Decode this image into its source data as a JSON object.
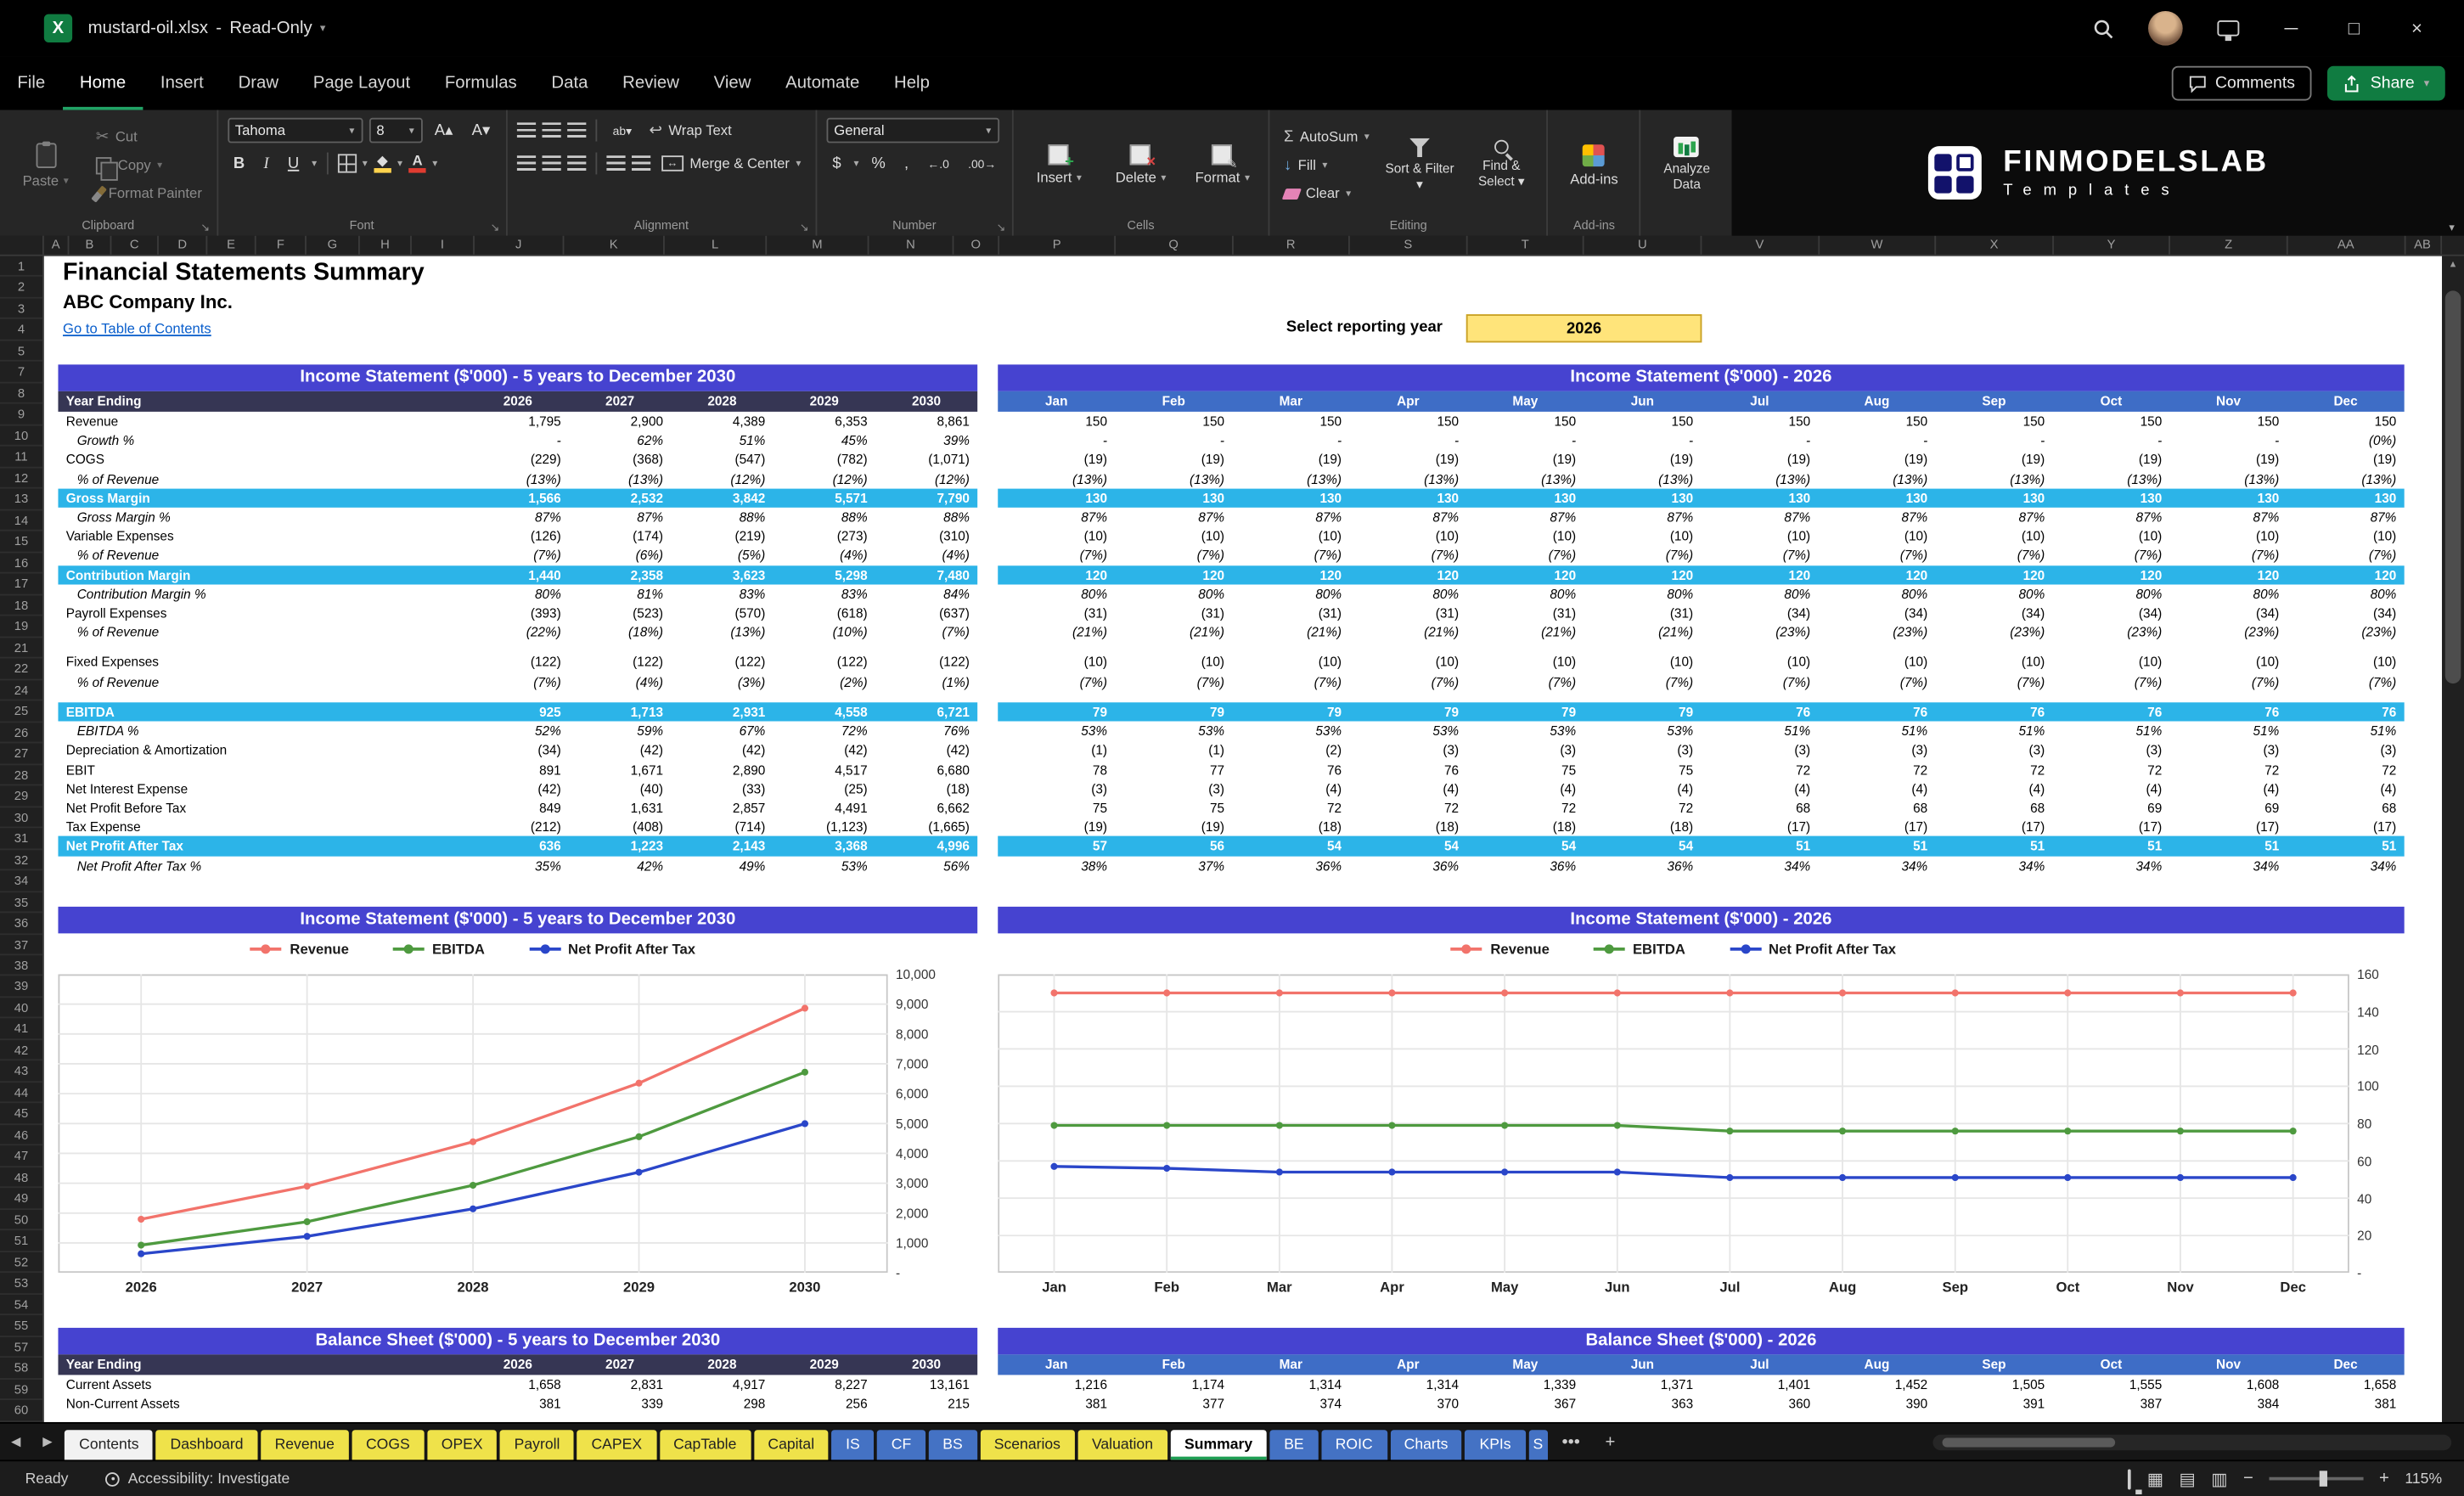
{
  "titlebar": {
    "filename": "mustard-oil.xlsx",
    "separator": "-",
    "mode": "Read-Only"
  },
  "menubar": {
    "items": [
      "File",
      "Home",
      "Insert",
      "Draw",
      "Page Layout",
      "Formulas",
      "Data",
      "Review",
      "View",
      "Automate",
      "Help"
    ],
    "active": "Home",
    "comments": "Comments",
    "share": "Share"
  },
  "ribbon": {
    "groups": {
      "clipboard": "Clipboard",
      "font": "Font",
      "alignment": "Alignment",
      "number": "Number",
      "cells": "Cells",
      "editing": "Editing",
      "addins": "Add-ins"
    },
    "paste": "Paste",
    "cut": "Cut",
    "copy": "Copy",
    "format_painter": "Format Painter",
    "font_name": "Tahoma",
    "font_size": "8",
    "wrap_text": "Wrap Text",
    "merge_center": "Merge & Center",
    "number_format": "General",
    "insert": "Insert",
    "delete": "Delete",
    "format": "Format",
    "autosum": "AutoSum",
    "fill": "Fill",
    "clear": "Clear",
    "sort_filter": "Sort & Filter",
    "find_select": "Find & Select",
    "addins_btn": "Add-ins",
    "analyze": "Analyze Data"
  },
  "logo": {
    "title": "FINMODELSLAB",
    "subtitle": "Templates"
  },
  "grid": {
    "columns": [
      "A",
      "B",
      "C",
      "D",
      "E",
      "F",
      "G",
      "H",
      "I",
      "J",
      "K",
      "L",
      "M",
      "N",
      "O",
      "P",
      "Q",
      "R",
      "S",
      "T",
      "U",
      "V",
      "W",
      "X",
      "Y",
      "Z",
      "AA",
      "AB"
    ],
    "rows": [
      1,
      2,
      3,
      4,
      5,
      7,
      8,
      9,
      10,
      11,
      12,
      13,
      14,
      15,
      16,
      17,
      18,
      19,
      21,
      22,
      24,
      25,
      26,
      27,
      28,
      29,
      30,
      31,
      32,
      34,
      35,
      36,
      37,
      38,
      39,
      40,
      41,
      42,
      43,
      44,
      45,
      46,
      47,
      48,
      49,
      50,
      51,
      52,
      53,
      54,
      55,
      57,
      58,
      59,
      60
    ]
  },
  "sheet": {
    "title": "Financial Statements Summary",
    "company": "ABC Company Inc.",
    "toc": "Go to Table of Contents",
    "year_label": "Select reporting year",
    "year": "2026"
  },
  "annual_is": {
    "title": "Income Statement ($'000) - 5 years to December 2030",
    "header_label": "Year Ending",
    "columns": [
      "2026",
      "2027",
      "2028",
      "2029",
      "2030"
    ],
    "rows": [
      {
        "label": "Revenue",
        "style": "n",
        "values": [
          "1,795",
          "2,900",
          "4,389",
          "6,353",
          "8,861"
        ]
      },
      {
        "label": "Growth %",
        "style": "p",
        "values": [
          "-",
          "62%",
          "51%",
          "45%",
          "39%"
        ]
      },
      {
        "label": "COGS",
        "style": "n",
        "values": [
          "(229)",
          "(368)",
          "(547)",
          "(782)",
          "(1,071)"
        ]
      },
      {
        "label": "% of Revenue",
        "style": "p",
        "values": [
          "(13%)",
          "(13%)",
          "(12%)",
          "(12%)",
          "(12%)"
        ]
      },
      {
        "label": "Gross Margin",
        "style": "h",
        "values": [
          "1,566",
          "2,532",
          "3,842",
          "5,571",
          "7,790"
        ]
      },
      {
        "label": "Gross Margin %",
        "style": "p",
        "values": [
          "87%",
          "87%",
          "88%",
          "88%",
          "88%"
        ]
      },
      {
        "label": "Variable Expenses",
        "style": "n",
        "values": [
          "(126)",
          "(174)",
          "(219)",
          "(273)",
          "(310)"
        ]
      },
      {
        "label": "% of Revenue",
        "style": "p",
        "values": [
          "(7%)",
          "(6%)",
          "(5%)",
          "(4%)",
          "(4%)"
        ]
      },
      {
        "label": "Contribution Margin",
        "style": "h",
        "values": [
          "1,440",
          "2,358",
          "3,623",
          "5,298",
          "7,480"
        ]
      },
      {
        "label": "Contribution Margin %",
        "style": "p",
        "values": [
          "80%",
          "81%",
          "83%",
          "83%",
          "84%"
        ]
      },
      {
        "label": "Payroll Expenses",
        "style": "n",
        "values": [
          "(393)",
          "(523)",
          "(570)",
          "(618)",
          "(637)"
        ]
      },
      {
        "label": "% of Revenue",
        "style": "p",
        "values": [
          "(22%)",
          "(18%)",
          "(13%)",
          "(10%)",
          "(7%)"
        ]
      },
      {
        "style": "s"
      },
      {
        "label": "Fixed Expenses",
        "style": "n",
        "values": [
          "(122)",
          "(122)",
          "(122)",
          "(122)",
          "(122)"
        ]
      },
      {
        "label": "% of Revenue",
        "style": "p",
        "values": [
          "(7%)",
          "(4%)",
          "(3%)",
          "(2%)",
          "(1%)"
        ]
      },
      {
        "style": "s"
      },
      {
        "label": "EBITDA",
        "style": "h",
        "values": [
          "925",
          "1,713",
          "2,931",
          "4,558",
          "6,721"
        ]
      },
      {
        "label": "EBITDA %",
        "style": "p",
        "values": [
          "52%",
          "59%",
          "67%",
          "72%",
          "76%"
        ]
      },
      {
        "label": "Depreciation & Amortization",
        "style": "n",
        "values": [
          "(34)",
          "(42)",
          "(42)",
          "(42)",
          "(42)"
        ]
      },
      {
        "label": "EBIT",
        "style": "n",
        "values": [
          "891",
          "1,671",
          "2,890",
          "4,517",
          "6,680"
        ]
      },
      {
        "label": "Net Interest Expense",
        "style": "n",
        "values": [
          "(42)",
          "(40)",
          "(33)",
          "(25)",
          "(18)"
        ]
      },
      {
        "label": "Net Profit Before Tax",
        "style": "n",
        "values": [
          "849",
          "1,631",
          "2,857",
          "4,491",
          "6,662"
        ]
      },
      {
        "label": "Tax Expense",
        "style": "n",
        "values": [
          "(212)",
          "(408)",
          "(714)",
          "(1,123)",
          "(1,665)"
        ]
      },
      {
        "label": "Net Profit After Tax",
        "style": "h",
        "values": [
          "636",
          "1,223",
          "2,143",
          "3,368",
          "4,996"
        ]
      },
      {
        "label": "Net Profit After Tax %",
        "style": "p",
        "values": [
          "35%",
          "42%",
          "49%",
          "53%",
          "56%"
        ]
      }
    ]
  },
  "monthly_is": {
    "title": "Income Statement ($'000) - 2026",
    "columns": [
      "Jan",
      "Feb",
      "Mar",
      "Apr",
      "May",
      "Jun",
      "Jul",
      "Aug",
      "Sep",
      "Oct",
      "Nov",
      "Dec"
    ],
    "rows": [
      {
        "style": "n",
        "values": [
          "150",
          "150",
          "150",
          "150",
          "150",
          "150",
          "150",
          "150",
          "150",
          "150",
          "150",
          "150"
        ]
      },
      {
        "style": "p",
        "values": [
          "-",
          "-",
          "-",
          "-",
          "-",
          "-",
          "-",
          "-",
          "-",
          "-",
          "-",
          "(0%)"
        ]
      },
      {
        "style": "n",
        "values": [
          "(19)",
          "(19)",
          "(19)",
          "(19)",
          "(19)",
          "(19)",
          "(19)",
          "(19)",
          "(19)",
          "(19)",
          "(19)",
          "(19)"
        ]
      },
      {
        "style": "p",
        "values": [
          "(13%)",
          "(13%)",
          "(13%)",
          "(13%)",
          "(13%)",
          "(13%)",
          "(13%)",
          "(13%)",
          "(13%)",
          "(13%)",
          "(13%)",
          "(13%)"
        ]
      },
      {
        "style": "h",
        "values": [
          "130",
          "130",
          "130",
          "130",
          "130",
          "130",
          "130",
          "130",
          "130",
          "130",
          "130",
          "130"
        ]
      },
      {
        "style": "p",
        "values": [
          "87%",
          "87%",
          "87%",
          "87%",
          "87%",
          "87%",
          "87%",
          "87%",
          "87%",
          "87%",
          "87%",
          "87%"
        ]
      },
      {
        "style": "n",
        "values": [
          "(10)",
          "(10)",
          "(10)",
          "(10)",
          "(10)",
          "(10)",
          "(10)",
          "(10)",
          "(10)",
          "(10)",
          "(10)",
          "(10)"
        ]
      },
      {
        "style": "p",
        "values": [
          "(7%)",
          "(7%)",
          "(7%)",
          "(7%)",
          "(7%)",
          "(7%)",
          "(7%)",
          "(7%)",
          "(7%)",
          "(7%)",
          "(7%)",
          "(7%)"
        ]
      },
      {
        "style": "h",
        "values": [
          "120",
          "120",
          "120",
          "120",
          "120",
          "120",
          "120",
          "120",
          "120",
          "120",
          "120",
          "120"
        ]
      },
      {
        "style": "p",
        "values": [
          "80%",
          "80%",
          "80%",
          "80%",
          "80%",
          "80%",
          "80%",
          "80%",
          "80%",
          "80%",
          "80%",
          "80%"
        ]
      },
      {
        "style": "n",
        "values": [
          "(31)",
          "(31)",
          "(31)",
          "(31)",
          "(31)",
          "(31)",
          "(34)",
          "(34)",
          "(34)",
          "(34)",
          "(34)",
          "(34)"
        ]
      },
      {
        "style": "p",
        "values": [
          "(21%)",
          "(21%)",
          "(21%)",
          "(21%)",
          "(21%)",
          "(21%)",
          "(23%)",
          "(23%)",
          "(23%)",
          "(23%)",
          "(23%)",
          "(23%)"
        ]
      },
      {
        "style": "s"
      },
      {
        "style": "n",
        "values": [
          "(10)",
          "(10)",
          "(10)",
          "(10)",
          "(10)",
          "(10)",
          "(10)",
          "(10)",
          "(10)",
          "(10)",
          "(10)",
          "(10)"
        ]
      },
      {
        "style": "p",
        "values": [
          "(7%)",
          "(7%)",
          "(7%)",
          "(7%)",
          "(7%)",
          "(7%)",
          "(7%)",
          "(7%)",
          "(7%)",
          "(7%)",
          "(7%)",
          "(7%)"
        ]
      },
      {
        "style": "s"
      },
      {
        "style": "h",
        "values": [
          "79",
          "79",
          "79",
          "79",
          "79",
          "79",
          "76",
          "76",
          "76",
          "76",
          "76",
          "76"
        ]
      },
      {
        "style": "p",
        "values": [
          "53%",
          "53%",
          "53%",
          "53%",
          "53%",
          "53%",
          "51%",
          "51%",
          "51%",
          "51%",
          "51%",
          "51%"
        ]
      },
      {
        "style": "n",
        "values": [
          "(1)",
          "(1)",
          "(2)",
          "(3)",
          "(3)",
          "(3)",
          "(3)",
          "(3)",
          "(3)",
          "(3)",
          "(3)",
          "(3)"
        ]
      },
      {
        "style": "n",
        "values": [
          "78",
          "77",
          "76",
          "76",
          "75",
          "75",
          "72",
          "72",
          "72",
          "72",
          "72",
          "72"
        ]
      },
      {
        "style": "n",
        "values": [
          "(3)",
          "(3)",
          "(4)",
          "(4)",
          "(4)",
          "(4)",
          "(4)",
          "(4)",
          "(4)",
          "(4)",
          "(4)",
          "(4)"
        ]
      },
      {
        "style": "n",
        "values": [
          "75",
          "75",
          "72",
          "72",
          "72",
          "72",
          "68",
          "68",
          "68",
          "69",
          "69",
          "68"
        ]
      },
      {
        "style": "n",
        "values": [
          "(19)",
          "(19)",
          "(18)",
          "(18)",
          "(18)",
          "(18)",
          "(17)",
          "(17)",
          "(17)",
          "(17)",
          "(17)",
          "(17)"
        ]
      },
      {
        "style": "h",
        "values": [
          "57",
          "56",
          "54",
          "54",
          "54",
          "54",
          "51",
          "51",
          "51",
          "51",
          "51",
          "51"
        ]
      },
      {
        "style": "p",
        "values": [
          "38%",
          "37%",
          "36%",
          "36%",
          "36%",
          "36%",
          "34%",
          "34%",
          "34%",
          "34%",
          "34%",
          "34%"
        ]
      }
    ]
  },
  "annual_bs": {
    "title": "Balance Sheet ($'000) - 5 years to December 2030",
    "header_label": "Year Ending",
    "columns": [
      "2026",
      "2027",
      "2028",
      "2029",
      "2030"
    ],
    "rows": [
      {
        "label": "Current Assets",
        "style": "n",
        "values": [
          "1,658",
          "2,831",
          "4,917",
          "8,227",
          "13,161"
        ]
      },
      {
        "label": "Non-Current Assets",
        "style": "n",
        "values": [
          "381",
          "339",
          "298",
          "256",
          "215"
        ]
      }
    ]
  },
  "monthly_bs": {
    "title": "Balance Sheet ($'000) - 2026",
    "columns": [
      "Jan",
      "Feb",
      "Mar",
      "Apr",
      "May",
      "Jun",
      "Jul",
      "Aug",
      "Sep",
      "Oct",
      "Nov",
      "Dec"
    ],
    "rows": [
      {
        "style": "n",
        "values": [
          "1,216",
          "1,174",
          "1,314",
          "1,314",
          "1,339",
          "1,371",
          "1,401",
          "1,452",
          "1,505",
          "1,555",
          "1,608",
          "1,658"
        ]
      },
      {
        "style": "n",
        "values": [
          "381",
          "377",
          "374",
          "370",
          "367",
          "363",
          "360",
          "390",
          "391",
          "387",
          "384",
          "381"
        ]
      }
    ]
  },
  "chart_data": [
    {
      "type": "line",
      "title": "Income Statement ($'000) - 5 years to December 2030",
      "x": [
        "2026",
        "2027",
        "2028",
        "2029",
        "2030"
      ],
      "series": [
        {
          "name": "Revenue",
          "color": "#F2736B",
          "values": [
            1795,
            2900,
            4389,
            6353,
            8861
          ]
        },
        {
          "name": "EBITDA",
          "color": "#4E9A3F",
          "values": [
            925,
            1713,
            2931,
            4558,
            6721
          ]
        },
        {
          "name": "Net Profit After Tax",
          "color": "#2A46C9",
          "values": [
            636,
            1223,
            2143,
            3368,
            4996
          ]
        }
      ],
      "ylim": [
        0,
        10000
      ],
      "ytick_labels": [
        "10,000",
        "9,000",
        "8,000",
        "7,000",
        "6,000",
        "5,000",
        "4,000",
        "3,000",
        "2,000",
        "1,000",
        "-"
      ],
      "legend_position": "top",
      "grid": true
    },
    {
      "type": "line",
      "title": "Income Statement ($'000) - 2026",
      "x": [
        "Jan",
        "Feb",
        "Mar",
        "Apr",
        "May",
        "Jun",
        "Jul",
        "Aug",
        "Sep",
        "Oct",
        "Nov",
        "Dec"
      ],
      "series": [
        {
          "name": "Revenue",
          "color": "#F2736B",
          "values": [
            150,
            150,
            150,
            150,
            150,
            150,
            150,
            150,
            150,
            150,
            150,
            150
          ]
        },
        {
          "name": "EBITDA",
          "color": "#4E9A3F",
          "values": [
            79,
            79,
            79,
            79,
            79,
            79,
            76,
            76,
            76,
            76,
            76,
            76
          ]
        },
        {
          "name": "Net Profit After Tax",
          "color": "#2A46C9",
          "values": [
            57,
            56,
            54,
            54,
            54,
            54,
            51,
            51,
            51,
            51,
            51,
            51
          ]
        }
      ],
      "ylim": [
        0,
        160
      ],
      "ytick_labels": [
        "160",
        "140",
        "120",
        "100",
        "80",
        "60",
        "40",
        "20",
        "-"
      ],
      "legend_position": "top",
      "grid": true
    }
  ],
  "tabs": [
    {
      "label": "Contents",
      "color": "white"
    },
    {
      "label": "Dashboard",
      "color": "yellow"
    },
    {
      "label": "Revenue",
      "color": "yellow"
    },
    {
      "label": "COGS",
      "color": "yellow"
    },
    {
      "label": "OPEX",
      "color": "yellow"
    },
    {
      "label": "Payroll",
      "color": "yellow"
    },
    {
      "label": "CAPEX",
      "color": "yellow"
    },
    {
      "label": "CapTable",
      "color": "yellow"
    },
    {
      "label": "Capital",
      "color": "yellow"
    },
    {
      "label": "IS",
      "color": "blue"
    },
    {
      "label": "CF",
      "color": "blue"
    },
    {
      "label": "BS",
      "color": "blue"
    },
    {
      "label": "Scenarios",
      "color": "yellow"
    },
    {
      "label": "Valuation",
      "color": "yellow"
    },
    {
      "label": "Summary",
      "color": "active"
    },
    {
      "label": "BE",
      "color": "blue"
    },
    {
      "label": "ROIC",
      "color": "blue"
    },
    {
      "label": "Charts",
      "color": "blue"
    },
    {
      "label": "KPIs",
      "color": "blue"
    },
    {
      "label": "S",
      "color": "blue",
      "clipped": true
    }
  ],
  "tabbar": {
    "more": "•••",
    "add": "+"
  },
  "statusbar": {
    "ready": "Ready",
    "accessibility": "Accessibility: Investigate",
    "zoom": "115%"
  },
  "colors": {
    "header_purple": "#4643D0",
    "subheader_navy": "#363654",
    "month_blue": "#3E6DC6",
    "highlight_cyan": "#2CB4E8",
    "select_yellow": "#FFE47A",
    "tab_yellow": "#EFE24A",
    "tab_blue": "#4472C4",
    "excel_green": "#107C41"
  }
}
